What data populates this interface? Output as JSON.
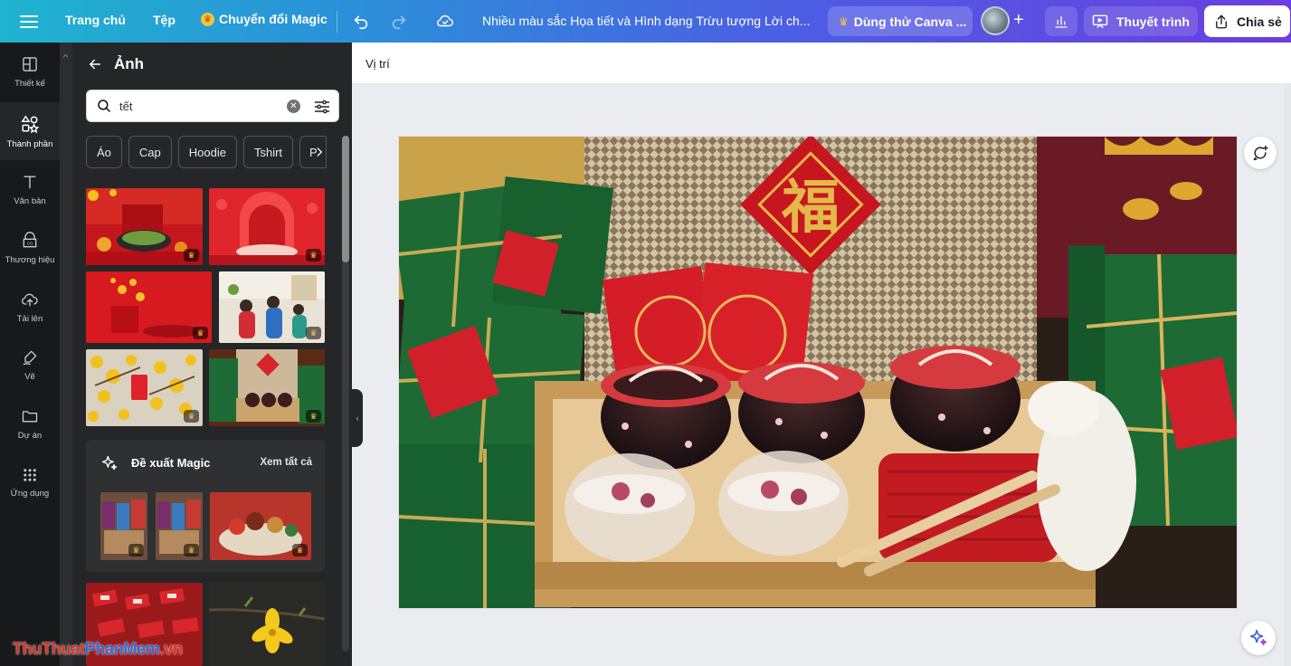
{
  "topbar": {
    "home": "Trang chủ",
    "file": "Tệp",
    "magic_switch": "Chuyển đổi Magic",
    "doc_title": "Nhiều màu sắc Họa tiết và Hình dạng Trừu tượng Lời ch...",
    "try_canva": "Dùng thử Canva ...",
    "present": "Thuyết trình",
    "share": "Chia sẻ"
  },
  "rail": {
    "items": [
      {
        "label": "Thiết kế",
        "icon": "layout-icon"
      },
      {
        "label": "Thành phần",
        "icon": "shapes-icon"
      },
      {
        "label": "Văn bản",
        "icon": "text-icon"
      },
      {
        "label": "Thương hiệu",
        "icon": "brand-icon"
      },
      {
        "label": "Tải lên",
        "icon": "upload-icon"
      },
      {
        "label": "Vẽ",
        "icon": "draw-icon"
      },
      {
        "label": "Dự án",
        "icon": "folder-icon"
      },
      {
        "label": "Ứng dụng",
        "icon": "apps-icon"
      }
    ]
  },
  "panel": {
    "title": "Ảnh",
    "search_value": "tết",
    "chips": [
      "Áo",
      "Cap",
      "Hoodie",
      "Tshirt"
    ],
    "chip_more": "P",
    "magic": {
      "title": "Đề xuất Magic",
      "see_all": "Xem tất cả"
    }
  },
  "editor": {
    "position_label": "Vị trí"
  },
  "watermark": {
    "part1": "ThuThuat",
    "part2": "PhanMem",
    "part3": ".vn"
  },
  "colors": {
    "accent_gradient_start": "#1fb4cf",
    "accent_gradient_end": "#6a3ee0",
    "panel_bg": "#252627",
    "rail_bg": "#18191b"
  }
}
